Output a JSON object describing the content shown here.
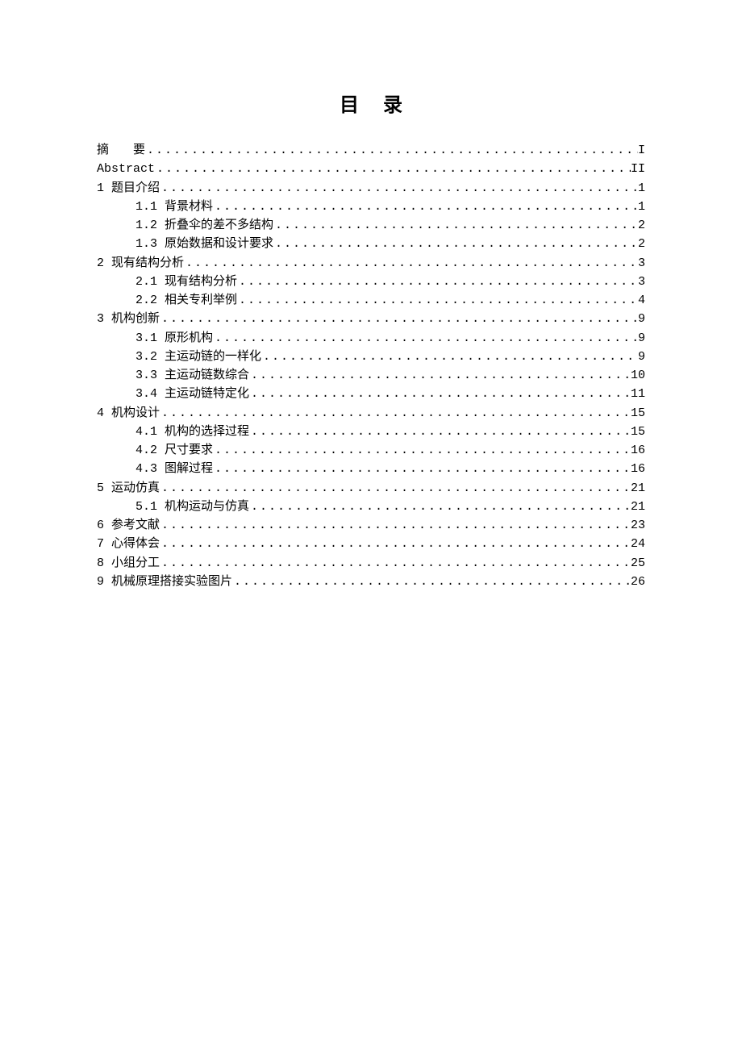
{
  "title": "目录",
  "entries": [
    {
      "level": 0,
      "label": "摘　　要",
      "page": "I"
    },
    {
      "level": 0,
      "label": "Abstract",
      "page": "II"
    },
    {
      "level": 0,
      "label": "1 题目介绍",
      "page": "1"
    },
    {
      "level": 1,
      "label": "1.1 背景材料",
      "page": "1"
    },
    {
      "level": 1,
      "label": "1.2 折叠伞的差不多结构",
      "page": "2"
    },
    {
      "level": 1,
      "label": "1.3 原始数据和设计要求",
      "page": "2"
    },
    {
      "level": 0,
      "label": "2 现有结构分析",
      "page": "3"
    },
    {
      "level": 1,
      "label": "2.1 现有结构分析",
      "page": "3"
    },
    {
      "level": 1,
      "label": "2.2 相关专利举例",
      "page": "4"
    },
    {
      "level": 0,
      "label": "3 机构创新",
      "page": "9"
    },
    {
      "level": 1,
      "label": "3.1 原形机构",
      "page": "9"
    },
    {
      "level": 1,
      "label": "3.2 主运动链的一样化",
      "page": "9"
    },
    {
      "level": 1,
      "label": "3.3 主运动链数综合",
      "page": "10"
    },
    {
      "level": 1,
      "label": "3.4 主运动链特定化",
      "page": "11"
    },
    {
      "level": 0,
      "label": "4 机构设计",
      "page": "15"
    },
    {
      "level": 1,
      "label": "4.1 机构的选择过程",
      "page": "15"
    },
    {
      "level": 1,
      "label": "4.2 尺寸要求",
      "page": "16"
    },
    {
      "level": 1,
      "label": "4.3 图解过程",
      "page": "16"
    },
    {
      "level": 0,
      "label": "5 运动仿真",
      "page": "21"
    },
    {
      "level": 1,
      "label": "5.1 机构运动与仿真",
      "page": "21"
    },
    {
      "level": 0,
      "label": "6 参考文献",
      "page": "23"
    },
    {
      "level": 0,
      "label": "7 心得体会",
      "page": "24"
    },
    {
      "level": 0,
      "label": "8 小组分工",
      "page": "25"
    },
    {
      "level": 0,
      "label": "9 机械原理搭接实验图片",
      "page": "26"
    }
  ]
}
